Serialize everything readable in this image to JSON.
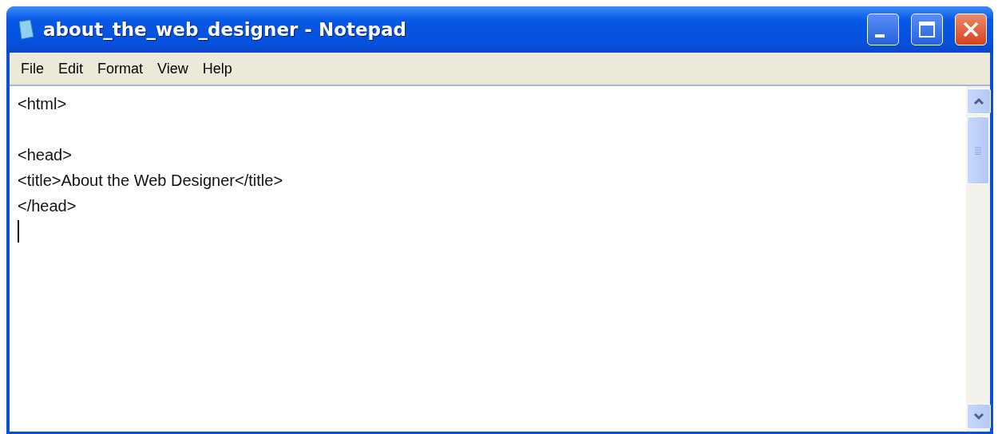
{
  "window": {
    "title": "about_the_web_designer - Notepad"
  },
  "menu": [
    {
      "label": "File"
    },
    {
      "label": "Edit"
    },
    {
      "label": "Format"
    },
    {
      "label": "View"
    },
    {
      "label": "Help"
    }
  ],
  "editor": {
    "lines": [
      {
        "kind": "code",
        "text": "<html>"
      },
      {
        "kind": "blank"
      },
      {
        "kind": "code",
        "text": "<head>"
      },
      {
        "kind": "code",
        "text": "<title>About the Web Designer</title>"
      },
      {
        "kind": "code",
        "text": "</head>"
      },
      {
        "kind": "caret"
      }
    ]
  }
}
